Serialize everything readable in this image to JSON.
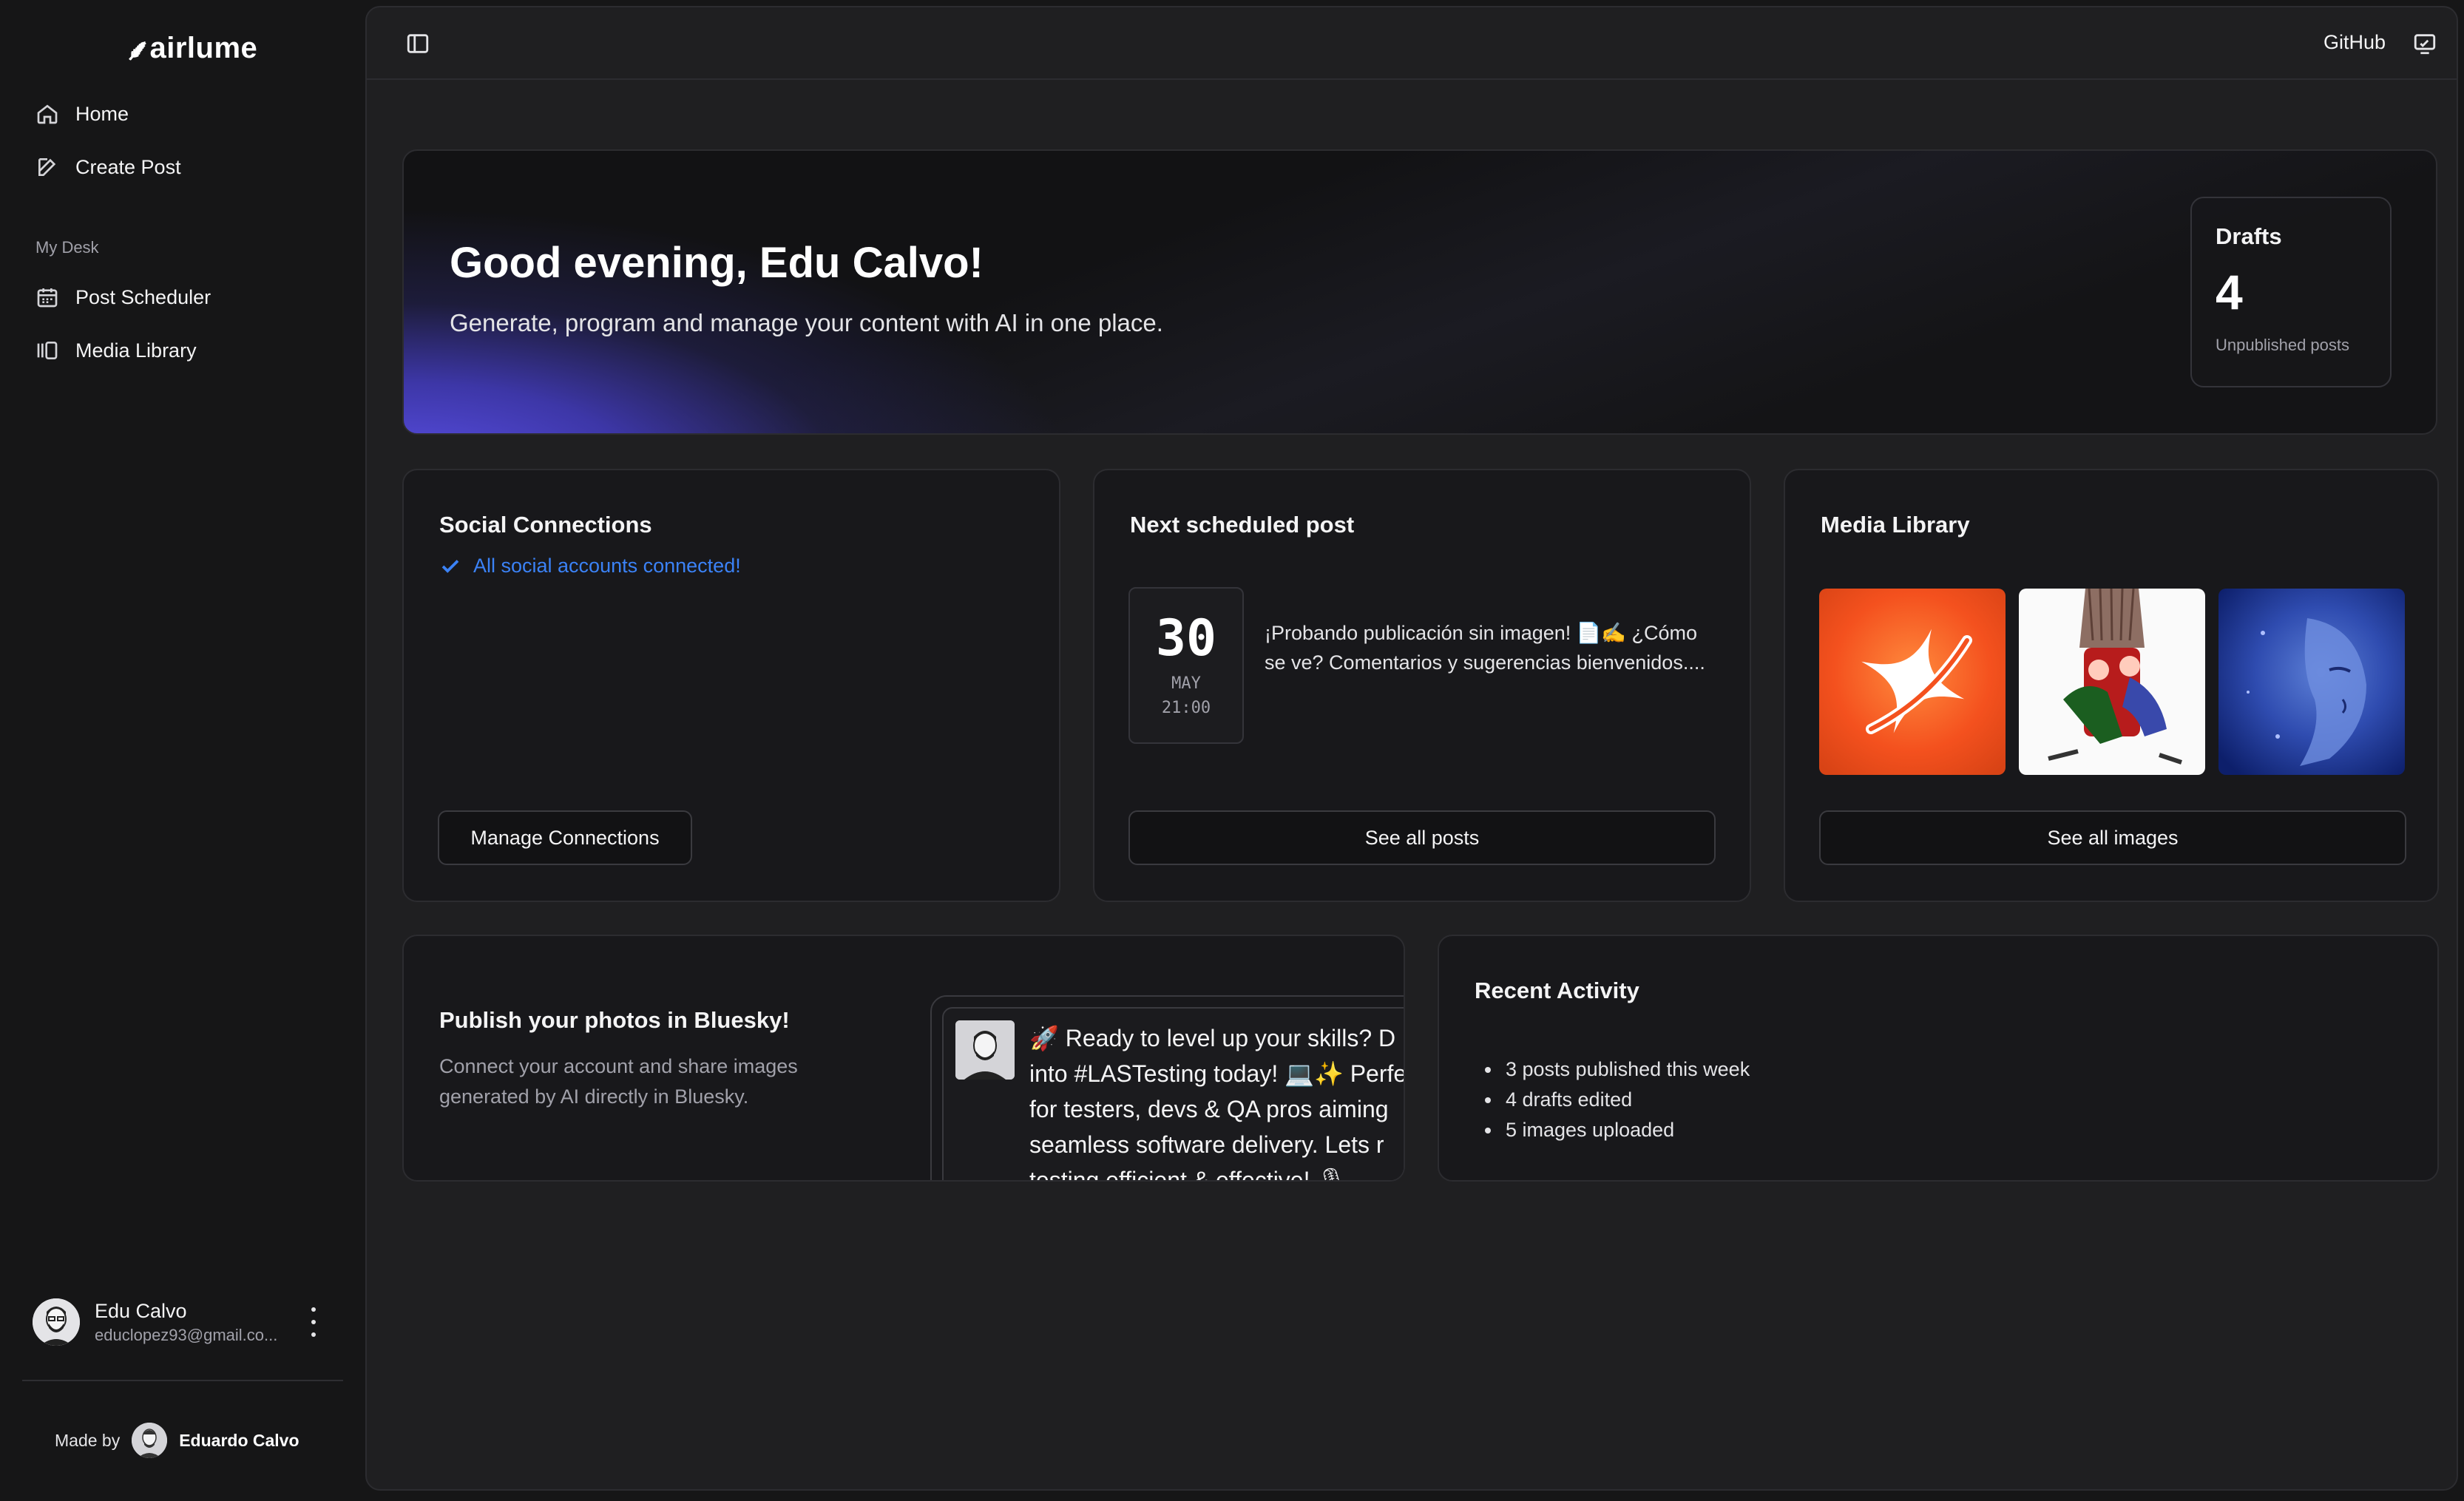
{
  "app": {
    "logo": "airlume",
    "sidebar": {
      "items": [
        {
          "label": "Home",
          "icon": "home-icon"
        },
        {
          "label": "Create Post",
          "icon": "edit-icon"
        }
      ],
      "section_label": "My Desk",
      "desk_items": [
        {
          "label": "Post Scheduler",
          "icon": "calendar-icon"
        },
        {
          "label": "Media Library",
          "icon": "library-icon"
        }
      ],
      "user": {
        "name": "Edu Calvo",
        "email": "educlopez93@gmail.co..."
      },
      "made_by": {
        "prefix": "Made by",
        "author": "Eduardo Calvo"
      }
    },
    "topbar": {
      "github_label": "GitHub"
    }
  },
  "hero": {
    "title": "Good evening, Edu Calvo!",
    "subtitle": "Generate, program and manage your content with AI in one place.",
    "drafts": {
      "title": "Drafts",
      "count": "4",
      "label": "Unpublished posts"
    }
  },
  "social": {
    "title": "Social Connections",
    "status": "All social accounts connected!",
    "button": "Manage Connections"
  },
  "scheduled": {
    "title": "Next scheduled post",
    "day": "30",
    "month": "MAY",
    "time": "21:00",
    "preview": "¡Probando publicación sin imagen! 📄✍️ ¿Cómo se ve? Comentarios y sugerencias bienvenidos....",
    "button": "See all posts"
  },
  "media": {
    "title": "Media Library",
    "button": "See all images"
  },
  "bluesky": {
    "title": "Publish your photos in Bluesky!",
    "subtitle": "Connect your account and share images generated by AI directly in Bluesky.",
    "post_text": "🚀 Ready to level up your skills? D\ninto #LASTesting today! 💻✨ Perfe\nfor testers, devs & QA pros aiming\nseamless software delivery. Lets r\ntesting efficient & effective! 🎙"
  },
  "activity": {
    "title": "Recent Activity",
    "items": [
      "3 posts published this week",
      "4 drafts edited",
      "5 images uploaded"
    ]
  },
  "colors": {
    "accent": "#3b82f6",
    "hero_glow": "#5b50e8",
    "background": "#161617",
    "card": "#18181b"
  }
}
